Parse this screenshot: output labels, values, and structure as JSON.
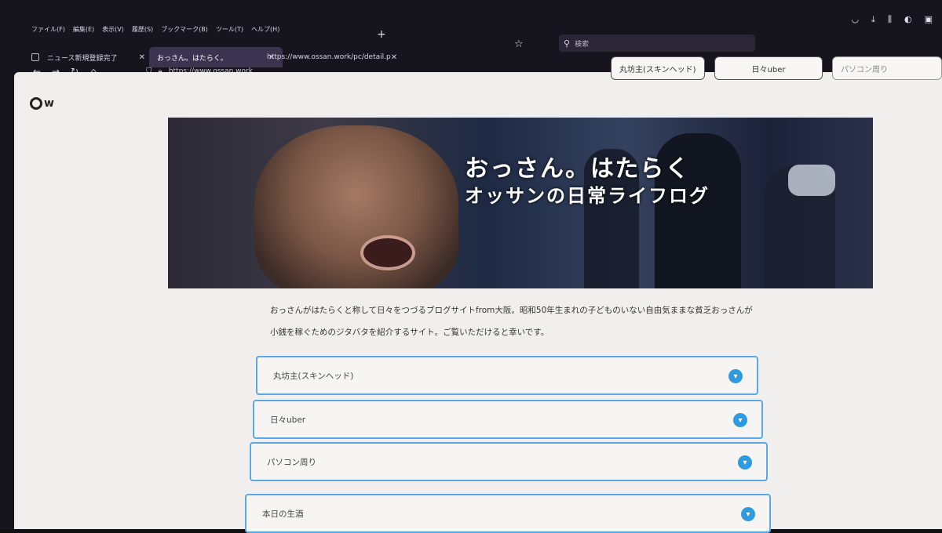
{
  "browser": {
    "menu": [
      "ファイル(F)",
      "編集(E)",
      "表示(V)",
      "履歴(S)",
      "ブックマーク(B)",
      "ツール(T)",
      "ヘルプ(H)"
    ],
    "tabs": [
      {
        "label": "ニュース新規登録完了"
      },
      {
        "label": "おっさん。はたらく。"
      },
      {
        "label": "https://www.ossan.work/pc/detail.p"
      }
    ],
    "new_tab": "+",
    "url": "https://www.ossan.work",
    "search_placeholder": "検索"
  },
  "site": {
    "logo_text": "w",
    "nav": [
      "丸坊主(スキンヘッド)",
      "日々uber",
      "パソコン周り"
    ],
    "hero_title": "おっさん。はたらく",
    "hero_subtitle": "オッサンの日常ライフログ",
    "description": "おっさんがはたらくと称して日々をつづるブログサイトfrom大阪。昭和50年生まれの子どものいない自由気ままな貧乏おっさんが小銭を稼ぐためのジタバタを紹介するサイト。ご覧いただけると幸いです。",
    "accordion": [
      {
        "label": "丸坊主(スキンヘッド)"
      },
      {
        "label": "日々uber"
      },
      {
        "label": "パソコン周り"
      },
      {
        "label": "本日の生酒"
      }
    ]
  },
  "colors": {
    "accent": "#2f9ae0",
    "border": "#5aa7e6"
  }
}
